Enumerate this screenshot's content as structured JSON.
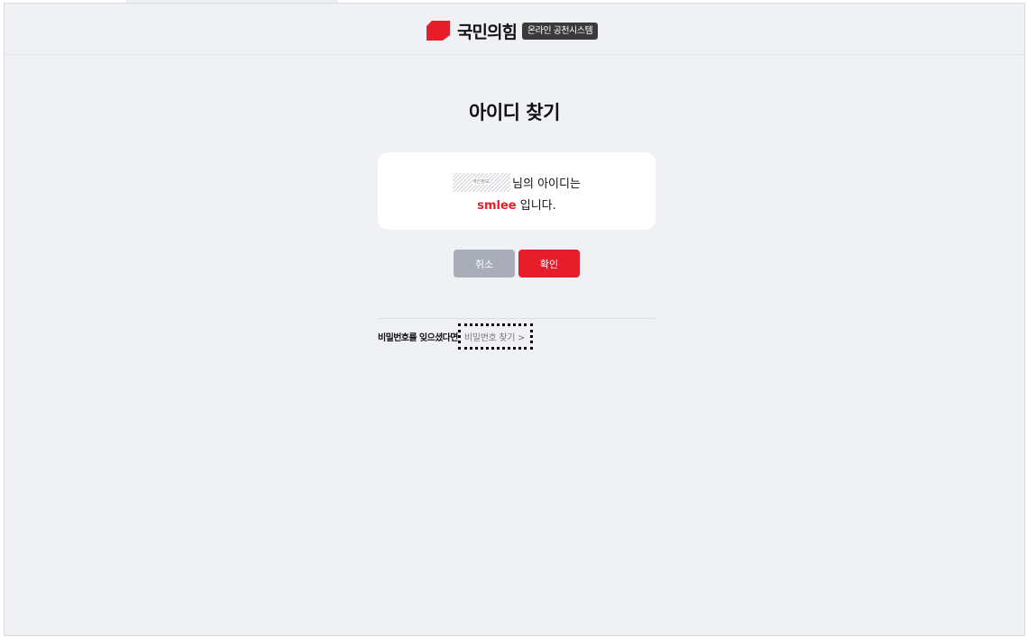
{
  "header": {
    "brand": "국민의힘",
    "system_badge": "온라인 공천시스템",
    "brand_color": "#e61e2b"
  },
  "page": {
    "title": "아이디 찾기"
  },
  "result": {
    "masked_label": "개인정보",
    "name_suffix": "님의 아이디는",
    "user_id": "smlee",
    "id_suffix": " 입니다."
  },
  "buttons": {
    "cancel": "취소",
    "confirm": "확인"
  },
  "help": {
    "label": "비밀번호를 잊으셨다면",
    "link": "비밀번호 찾기 >"
  }
}
